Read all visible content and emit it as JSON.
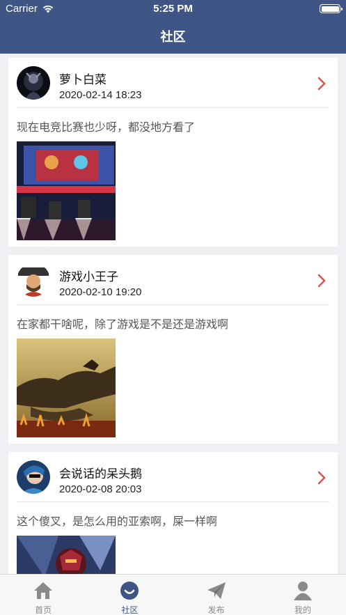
{
  "status_bar": {
    "carrier": "Carrier",
    "time": "5:25 PM",
    "battery_level": 1.0
  },
  "nav": {
    "title": "社区"
  },
  "posts": [
    {
      "username": "萝卜白菜",
      "date": "2020-02-14 18:23",
      "content": "现在电竞比赛也少呀，都没地方看了",
      "image_subject": "esports-stage"
    },
    {
      "username": "游戏小王子",
      "date": "2020-02-10 19:20",
      "content": "在家都干啥呢，除了游戏是不是还是游戏啊",
      "image_subject": "dragon"
    },
    {
      "username": "会说话的呆头鹅",
      "date": "2020-02-08 20:03",
      "content": "这个傻叉，是怎么用的亚索啊，屎一样啊",
      "image_subject": "armored-hero"
    }
  ],
  "tabs": [
    {
      "label": "首页",
      "icon": "home-icon",
      "active": false
    },
    {
      "label": "社区",
      "icon": "community-icon",
      "active": true
    },
    {
      "label": "发布",
      "icon": "send-icon",
      "active": false
    },
    {
      "label": "我的",
      "icon": "profile-icon",
      "active": false
    }
  ],
  "colors": {
    "primary": "#3f5585",
    "accent_chevron": "#d9534f",
    "background": "#efeff4"
  }
}
